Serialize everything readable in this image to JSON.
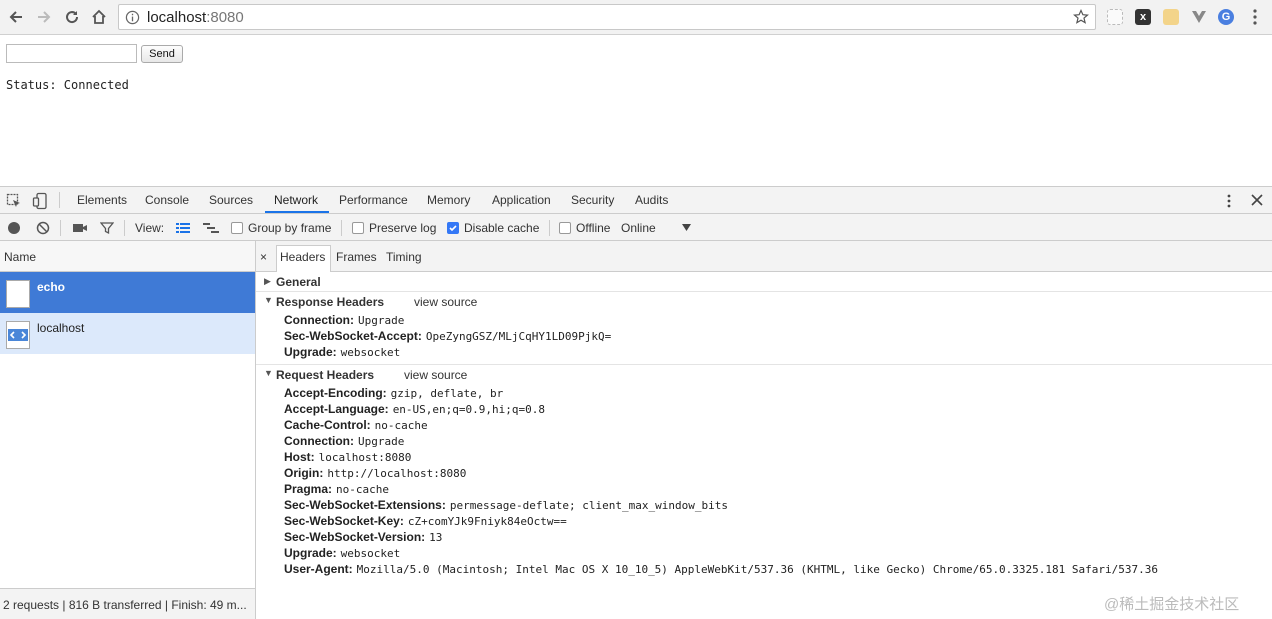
{
  "browser": {
    "url_host": "localhost",
    "url_port": ":8080"
  },
  "page": {
    "send_label": "Send",
    "input_value": "",
    "status_text": "Status: Connected"
  },
  "devtools": {
    "tabs": [
      "Elements",
      "Console",
      "Sources",
      "Network",
      "Performance",
      "Memory",
      "Application",
      "Security",
      "Audits"
    ],
    "active_tab": "Network",
    "toolbar": {
      "view_label": "View:",
      "group_by_frame": "Group by frame",
      "preserve_log": "Preserve log",
      "disable_cache": "Disable cache",
      "offline": "Offline",
      "throttle": "Online"
    },
    "requests": {
      "column_name": "Name",
      "items": [
        "echo",
        "localhost"
      ],
      "footer": "2 requests | 816 B transferred | Finish: 49 m..."
    },
    "detail_tabs": {
      "close": "×",
      "headers": "Headers",
      "frames": "Frames",
      "timing": "Timing"
    },
    "general_title": "General",
    "response": {
      "title": "Response Headers",
      "view_source": "view source",
      "rows": [
        {
          "k": "Connection:",
          "v": "Upgrade"
        },
        {
          "k": "Sec-WebSocket-Accept:",
          "v": "OpeZyngGSZ/MLjCqHY1LD09PjkQ="
        },
        {
          "k": "Upgrade:",
          "v": "websocket"
        }
      ]
    },
    "request": {
      "title": "Request Headers",
      "view_source": "view source",
      "rows": [
        {
          "k": "Accept-Encoding:",
          "v": "gzip, deflate, br"
        },
        {
          "k": "Accept-Language:",
          "v": "en-US,en;q=0.9,hi;q=0.8"
        },
        {
          "k": "Cache-Control:",
          "v": "no-cache"
        },
        {
          "k": "Connection:",
          "v": "Upgrade"
        },
        {
          "k": "Host:",
          "v": "localhost:8080"
        },
        {
          "k": "Origin:",
          "v": "http://localhost:8080"
        },
        {
          "k": "Pragma:",
          "v": "no-cache"
        },
        {
          "k": "Sec-WebSocket-Extensions:",
          "v": "permessage-deflate; client_max_window_bits"
        },
        {
          "k": "Sec-WebSocket-Key:",
          "v": "cZ+comYJk9Fniyk84eOctw=="
        },
        {
          "k": "Sec-WebSocket-Version:",
          "v": "13"
        },
        {
          "k": "Upgrade:",
          "v": "websocket"
        },
        {
          "k": "User-Agent:",
          "v": "Mozilla/5.0 (Macintosh; Intel Mac OS X 10_10_5) AppleWebKit/537.36 (KHTML, like Gecko) Chrome/65.0.3325.181 Safari/537.36"
        }
      ]
    }
  },
  "watermark": "@稀土掘金技术社区",
  "colors": {
    "selected_row": "#3f7ad6",
    "alt_row": "#dce9fb",
    "accent": "#1a73e8"
  }
}
